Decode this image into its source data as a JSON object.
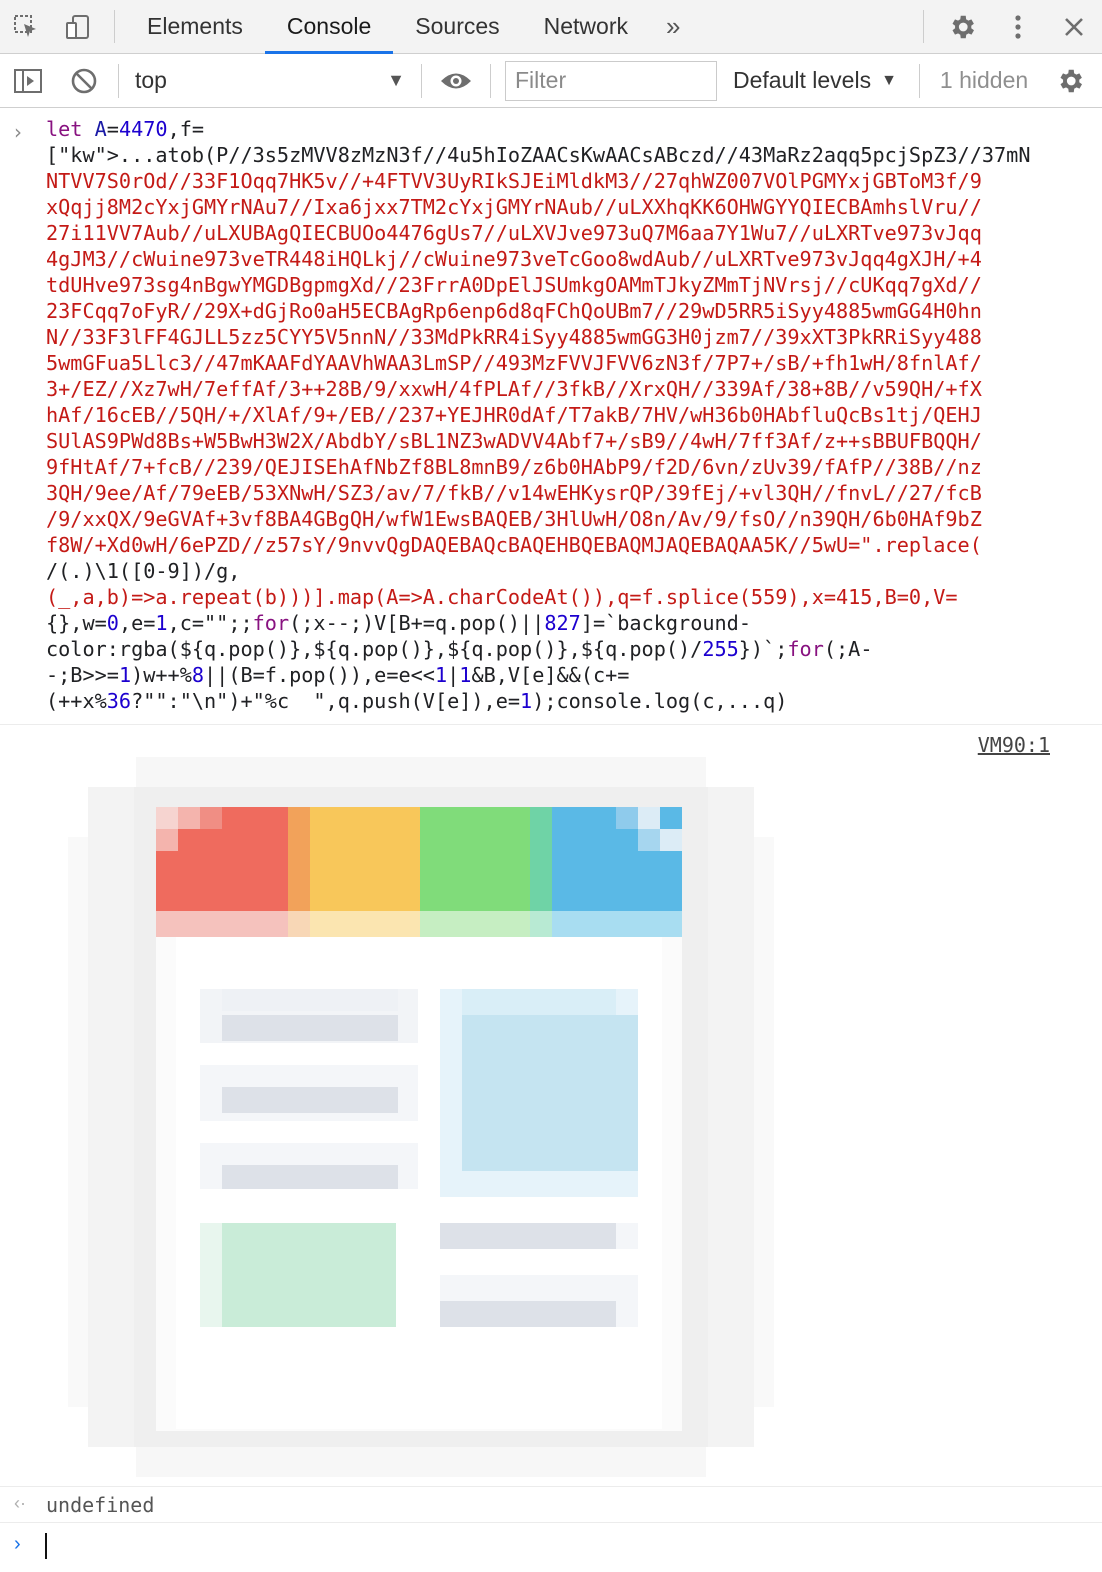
{
  "tabbar": {
    "tabs": [
      "Elements",
      "Console",
      "Sources",
      "Network"
    ],
    "active_tab": "Console",
    "more": "»"
  },
  "toolbar": {
    "context": "top",
    "filter_placeholder": "Filter",
    "levels": "Default levels",
    "hidden": "1 hidden"
  },
  "console": {
    "code_lines": [
      "let A=4470,f=",
      "[...atob(\"P//3s5zMVV8zMzN3f//4u5hIoZAACsKwAACsABczd//43MaRz2aqq5pcjSpZ3//37mN",
      "NTVV7S0rOd//33F1Oqq7HK5v//+4FTVV3UyRIkSJEiMldkM3//27qhWZ007VOlPGMYxjGBToM3f/9",
      "xQqjj8M2cYxjGMYrNAu7//Ixa6jxx7TM2cYxjGMYrNAub//uLXXhqKK6OHWGYYQIECBAmhslVru//",
      "27i11VV7Aub//uLXUBAgQIECBUOo4476gUs7//uLXVJve973uQ7M6aa7Y1Wu7//uLXRTve973vJqq",
      "4gJM3//cWuine973veTR448iHQLkj//cWuine973veTcGoo8wdAub//uLXRTve973vJqq4gXJH/+4",
      "tdUHve973sg4nBgwYMGDBgpmgXd//23FrrA0DpElJSUmkgOAMmTJkyZMmTjNVrsj//cUKqq7gXd//",
      "23FCqq7oFyR//29X+dGjRo0aH5ECBAgRp6enp6d8qFChQoUBm7//29wD5RR5iSyy4885wmGG4H0hn",
      "N//33F3lFF4GJLL5zz5CYY5V5nnN//33MdPkRR4iSyy4885wmGG3H0jzm7//39xXT3PkRRiSyy488",
      "5wmGFua5Llc3//47mKAAFdYAAVhWAA3LmSP//493MzFVVJFVV6zN3f/7P7+/sB/+fh1wH/8fnlAf/",
      "3+/EZ//Xz7wH/7effAf/3++28B/9/xxwH/4fPLAf//3fkB//XrxQH//339Af/38+8B//v59QH/+fX",
      "hAf/16cEB//5QH/+/XlAf/9+/EB//237+YEJHR0dAf/T7akB/7HV/wH36b0HAbfluQcBs1tj/QEHJ",
      "SUlAS9PWd8Bs+W5BwH3W2X/AbdbY/sBL1NZ3wADVV4Abf7+/sB9//4wH/7ff3Af/z++sBBUFBQQH/",
      "9fHtAf/7+fcB//239/QEJISEhAfNbZf8BL8mnB9/z6b0HAbP9/f2D/6vn/zUv39/fAfP//38B//nz",
      "3QH/9ee/Af/79eEB/53XNwH/SZ3/av/7/fkB//v14wEHKysrQP/39fEj/+vl3QH//fnvL//27/fcB",
      "/9/xxQX/9eGVAf+3vf8BA4GBgQH/wfW1EwsBAQEB/3HlUwH/O8n/Av/9/fsO//n39QH/6b0HAf9bZ",
      "f8W/+Xd0wH/6ePZD//z57sY/9nvvQgDAQEBAQcBAQEHBQEBAQMJAQEBAQAA5K//5wU=\".replace(",
      "/(.)\\1([0-9])/g,",
      "(_,a,b)=>a.repeat(b)))].map(A=>A.charCodeAt()),q=f.splice(559),x=415,B=0,V=",
      "{},w=0,e=1,c=\"\";;for(;x--;)V[B+=q.pop()||827]=`background-",
      "color:rgba(${q.pop()},${q.pop()},${q.pop()},${q.pop()/255})`;for(;A-",
      "-;B>>=1)w++%8||(B=f.pop()),e=e<<1|1&B,V[e]&&(c+=",
      "(++x%36?\"\":\"\\n\")+\"%c  \",q.push(V[e]),e=1);console.log(c,...q)"
    ],
    "source_link": "VM90:1",
    "result": "undefined"
  },
  "colors": {
    "accent": "#1a73e8",
    "red": "#ef6b5e",
    "orange": "#f2a25a",
    "yellow": "#f8c75a",
    "green": "#80dc7a",
    "teal": "#6fd3a6",
    "blue": "#5ab9e6"
  }
}
